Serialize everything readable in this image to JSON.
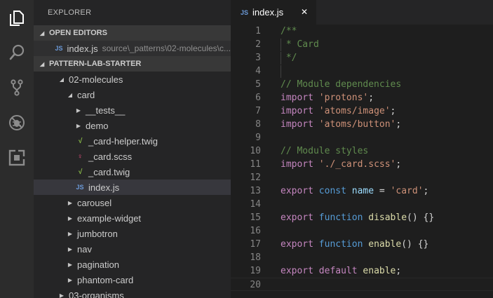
{
  "sidebar": {
    "title": "EXPLORER",
    "open_editors_header": "OPEN EDITORS",
    "open_editor_item": {
      "name": "index.js",
      "description": "source\\_patterns\\02-molecules\\c..."
    },
    "project_header": "PATTERN-LAB-STARTER",
    "tree": [
      {
        "label": "02-molecules",
        "kind": "folder-open"
      },
      {
        "label": "card",
        "kind": "folder-open"
      },
      {
        "label": "__tests__",
        "kind": "folder"
      },
      {
        "label": "demo",
        "kind": "folder"
      },
      {
        "label": "_card-helper.twig",
        "kind": "twig"
      },
      {
        "label": "_card.scss",
        "kind": "scss"
      },
      {
        "label": "_card.twig",
        "kind": "twig"
      },
      {
        "label": "index.js",
        "kind": "js"
      },
      {
        "label": "carousel",
        "kind": "folder"
      },
      {
        "label": "example-widget",
        "kind": "folder"
      },
      {
        "label": "jumbotron",
        "kind": "folder"
      },
      {
        "label": "nav",
        "kind": "folder"
      },
      {
        "label": "pagination",
        "kind": "folder"
      },
      {
        "label": "phantom-card",
        "kind": "folder"
      },
      {
        "label": "03-organisms",
        "kind": "folder"
      }
    ]
  },
  "icons": {
    "js": "JS",
    "twig": "√",
    "scss": "♀",
    "expanded": "◢",
    "collapsed": "▶",
    "close": "✕"
  },
  "editor": {
    "active_tab": "index.js",
    "lines": [
      {
        "n": "1",
        "tokens": [
          [
            "cm",
            "/**"
          ]
        ]
      },
      {
        "n": "2",
        "tokens": [
          [
            "cm",
            " * Card"
          ]
        ]
      },
      {
        "n": "3",
        "tokens": [
          [
            "cm",
            " */"
          ]
        ]
      },
      {
        "n": "4",
        "tokens": []
      },
      {
        "n": "5",
        "tokens": [
          [
            "cm",
            "// Module dependencies"
          ]
        ]
      },
      {
        "n": "6",
        "tokens": [
          [
            "kw",
            "import"
          ],
          [
            "pun",
            " "
          ],
          [
            "str",
            "'protons'"
          ],
          [
            "pun",
            ";"
          ]
        ]
      },
      {
        "n": "7",
        "tokens": [
          [
            "kw",
            "import"
          ],
          [
            "pun",
            " "
          ],
          [
            "str",
            "'atoms/image'"
          ],
          [
            "pun",
            ";"
          ]
        ]
      },
      {
        "n": "8",
        "tokens": [
          [
            "kw",
            "import"
          ],
          [
            "pun",
            " "
          ],
          [
            "str",
            "'atoms/button'"
          ],
          [
            "pun",
            ";"
          ]
        ]
      },
      {
        "n": "9",
        "tokens": []
      },
      {
        "n": "10",
        "tokens": [
          [
            "cm",
            "// Module styles"
          ]
        ]
      },
      {
        "n": "11",
        "tokens": [
          [
            "kw",
            "import"
          ],
          [
            "pun",
            " "
          ],
          [
            "str",
            "'./_card.scss'"
          ],
          [
            "pun",
            ";"
          ]
        ]
      },
      {
        "n": "12",
        "tokens": []
      },
      {
        "n": "13",
        "tokens": [
          [
            "kw",
            "export"
          ],
          [
            "pun",
            " "
          ],
          [
            "kw2",
            "const"
          ],
          [
            "pun",
            " "
          ],
          [
            "var",
            "name"
          ],
          [
            "pun",
            " = "
          ],
          [
            "str",
            "'card'"
          ],
          [
            "pun",
            ";"
          ]
        ]
      },
      {
        "n": "14",
        "tokens": []
      },
      {
        "n": "15",
        "tokens": [
          [
            "kw",
            "export"
          ],
          [
            "pun",
            " "
          ],
          [
            "kw2",
            "function"
          ],
          [
            "pun",
            " "
          ],
          [
            "fn",
            "disable"
          ],
          [
            "pun",
            "() {}"
          ]
        ]
      },
      {
        "n": "16",
        "tokens": []
      },
      {
        "n": "17",
        "tokens": [
          [
            "kw",
            "export"
          ],
          [
            "pun",
            " "
          ],
          [
            "kw2",
            "function"
          ],
          [
            "pun",
            " "
          ],
          [
            "fn",
            "enable"
          ],
          [
            "pun",
            "() {}"
          ]
        ]
      },
      {
        "n": "18",
        "tokens": []
      },
      {
        "n": "19",
        "tokens": [
          [
            "kw",
            "export"
          ],
          [
            "pun",
            " "
          ],
          [
            "kw",
            "default"
          ],
          [
            "pun",
            " "
          ],
          [
            "fn",
            "enable"
          ],
          [
            "pun",
            ";"
          ]
        ]
      },
      {
        "n": "20",
        "tokens": []
      }
    ]
  }
}
